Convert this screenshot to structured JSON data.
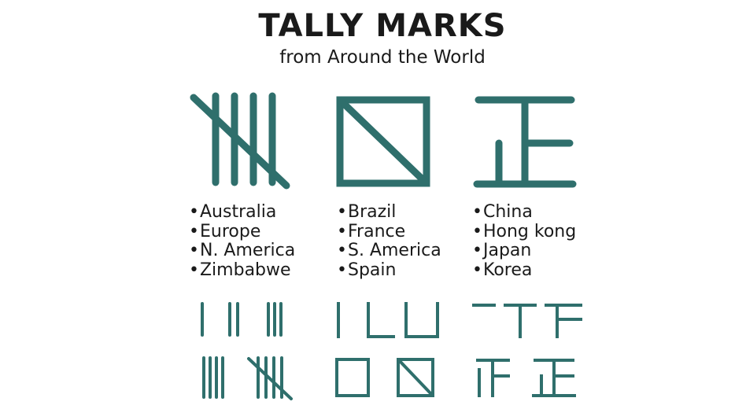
{
  "title": "TALLY MARKS",
  "subtitle": "from Around the World",
  "colors": {
    "mark": "#2f6f6c",
    "text": "#1a1a1a"
  },
  "systems": [
    {
      "name": "tally",
      "countries": [
        "Australia",
        "Europe",
        "N. America",
        "Zimbabwe"
      ]
    },
    {
      "name": "square",
      "countries": [
        "Brazil",
        "France",
        "S. America",
        "Spain"
      ]
    },
    {
      "name": "zheng",
      "countries": [
        "China",
        "Hong kong",
        "Japan",
        "Korea"
      ]
    }
  ]
}
